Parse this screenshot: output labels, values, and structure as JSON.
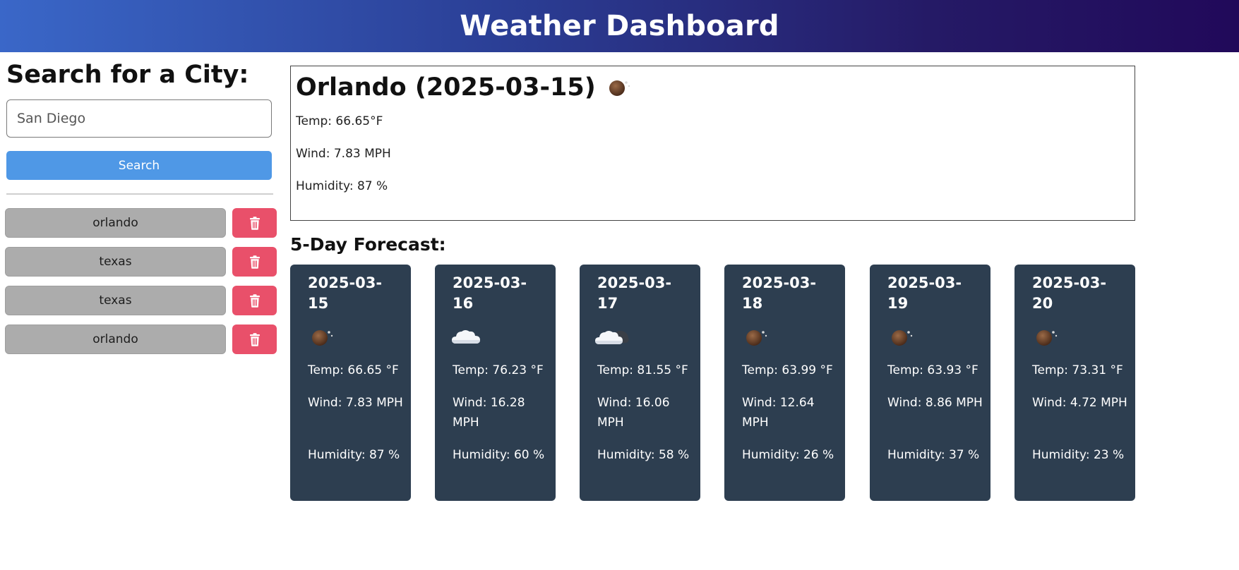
{
  "header": {
    "title": "Weather Dashboard"
  },
  "sidebar": {
    "search_title": "Search for a City:",
    "search_value": "San Diego",
    "search_button": "Search",
    "history": [
      {
        "city": "orlando"
      },
      {
        "city": "texas"
      },
      {
        "city": "texas"
      },
      {
        "city": "orlando"
      }
    ],
    "delete_icon": "trash-icon",
    "delete_color": "#e9506a"
  },
  "current": {
    "title": "Orlando (2025-03-15)",
    "icon": "moon-icon",
    "temp": "Temp: 66.65°F",
    "wind": "Wind: 7.83 MPH",
    "humidity": "Humidity: 87 %"
  },
  "forecast": {
    "title": "5-Day Forecast:",
    "days": [
      {
        "date": "2025-03-15",
        "icon": "moon-icon",
        "temp": "Temp: 66.65 °F",
        "wind": "Wind: 7.83 MPH",
        "humidity": "Humidity: 87 %"
      },
      {
        "date": "2025-03-16",
        "icon": "cloud-icon",
        "temp": "Temp: 76.23 °F",
        "wind": "Wind: 16.28 MPH",
        "humidity": "Humidity: 60 %"
      },
      {
        "date": "2025-03-17",
        "icon": "cloud-moon-icon",
        "temp": "Temp: 81.55 °F",
        "wind": "Wind: 16.06 MPH",
        "humidity": "Humidity: 58 %"
      },
      {
        "date": "2025-03-18",
        "icon": "moon-icon",
        "temp": "Temp: 63.99 °F",
        "wind": "Wind: 12.64 MPH",
        "humidity": "Humidity: 26 %"
      },
      {
        "date": "2025-03-19",
        "icon": "moon-icon",
        "temp": "Temp: 63.93 °F",
        "wind": "Wind: 8.86 MPH",
        "humidity": "Humidity: 37 %"
      },
      {
        "date": "2025-03-20",
        "icon": "moon-icon",
        "temp": "Temp: 73.31 °F",
        "wind": "Wind: 4.72 MPH",
        "humidity": "Humidity: 23 %"
      }
    ]
  },
  "colors": {
    "search_button": "#4f98e6",
    "card_background": "#2d3e50",
    "history_button": "#acacac"
  }
}
